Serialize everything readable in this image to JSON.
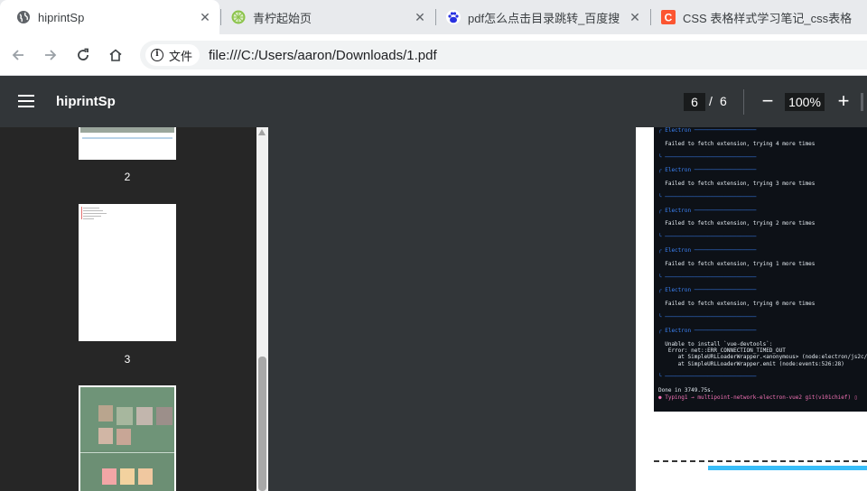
{
  "tabs": [
    {
      "title": "hiprintSp",
      "icon": "globe-icon",
      "active": true
    },
    {
      "title": "青柠起始页",
      "icon": "lime-icon",
      "active": false
    },
    {
      "title": "pdf怎么点击目录跳转_百度搜索",
      "icon": "baidu-paw-icon",
      "active": false
    },
    {
      "title": "CSS 表格样式学习笔记_css表格",
      "icon": "csdn-icon",
      "active": false
    }
  ],
  "omnibox": {
    "chip_label": "文件",
    "url": "file:///C:/Users/aaron/Downloads/1.pdf"
  },
  "pdf_toolbar": {
    "title": "hiprintSp",
    "current_page": "6",
    "separator": "/",
    "total_pages": "6",
    "zoom": "100%",
    "zoom_out": "−",
    "zoom_in": "+"
  },
  "thumbnails": [
    {
      "label": "2"
    },
    {
      "label": "3"
    },
    {
      "label": ""
    }
  ],
  "terminal": {
    "lines": [
      {
        "text": "╭ Electron ───────────────────",
        "cls": "t-blue"
      },
      {
        "text": "",
        "cls": ""
      },
      {
        "text": "  Failed to fetch extension, trying 4 more times",
        "cls": ""
      },
      {
        "text": "",
        "cls": ""
      },
      {
        "text": "╰ ────────────────────────────",
        "cls": "t-blue"
      },
      {
        "text": "",
        "cls": ""
      },
      {
        "text": "╭ Electron ───────────────────",
        "cls": "t-blue"
      },
      {
        "text": "",
        "cls": ""
      },
      {
        "text": "  Failed to fetch extension, trying 3 more times",
        "cls": ""
      },
      {
        "text": "",
        "cls": ""
      },
      {
        "text": "╰ ────────────────────────────",
        "cls": "t-blue"
      },
      {
        "text": "",
        "cls": ""
      },
      {
        "text": "╭ Electron ───────────────────",
        "cls": "t-blue"
      },
      {
        "text": "",
        "cls": ""
      },
      {
        "text": "  Failed to fetch extension, trying 2 more times",
        "cls": ""
      },
      {
        "text": "",
        "cls": ""
      },
      {
        "text": "╰ ────────────────────────────",
        "cls": "t-blue"
      },
      {
        "text": "",
        "cls": ""
      },
      {
        "text": "╭ Electron ───────────────────",
        "cls": "t-blue"
      },
      {
        "text": "",
        "cls": ""
      },
      {
        "text": "  Failed to fetch extension, trying 1 more times",
        "cls": ""
      },
      {
        "text": "",
        "cls": ""
      },
      {
        "text": "╰ ────────────────────────────",
        "cls": "t-blue"
      },
      {
        "text": "",
        "cls": ""
      },
      {
        "text": "╭ Electron ───────────────────",
        "cls": "t-blue"
      },
      {
        "text": "",
        "cls": ""
      },
      {
        "text": "  Failed to fetch extension, trying 0 more times",
        "cls": ""
      },
      {
        "text": "",
        "cls": ""
      },
      {
        "text": "╰ ────────────────────────────",
        "cls": "t-blue"
      },
      {
        "text": "",
        "cls": ""
      },
      {
        "text": "╭ Electron ───────────────────",
        "cls": "t-blue"
      },
      {
        "text": "",
        "cls": ""
      },
      {
        "text": "  Unable to install `vue-devtools`:",
        "cls": ""
      },
      {
        "text": "   Error: net::ERR_CONNECTION_TIMED_OUT",
        "cls": ""
      },
      {
        "text": "      at SimpleURLLoaderWrapper.<anonymous> (node:electron/js2c/br",
        "cls": ""
      },
      {
        "text": "      at SimpleURLLoaderWrapper.emit (node:events:526:28)",
        "cls": ""
      },
      {
        "text": "",
        "cls": ""
      },
      {
        "text": "╰ ────────────────────────────",
        "cls": "t-blue"
      },
      {
        "text": "",
        "cls": ""
      },
      {
        "text": "Done in 3749.75s.",
        "cls": ""
      },
      {
        "text": "● Typing1 → multipoint-network-electron-vue2 git(v101chief) ▯",
        "cls": "t-pink"
      }
    ]
  }
}
